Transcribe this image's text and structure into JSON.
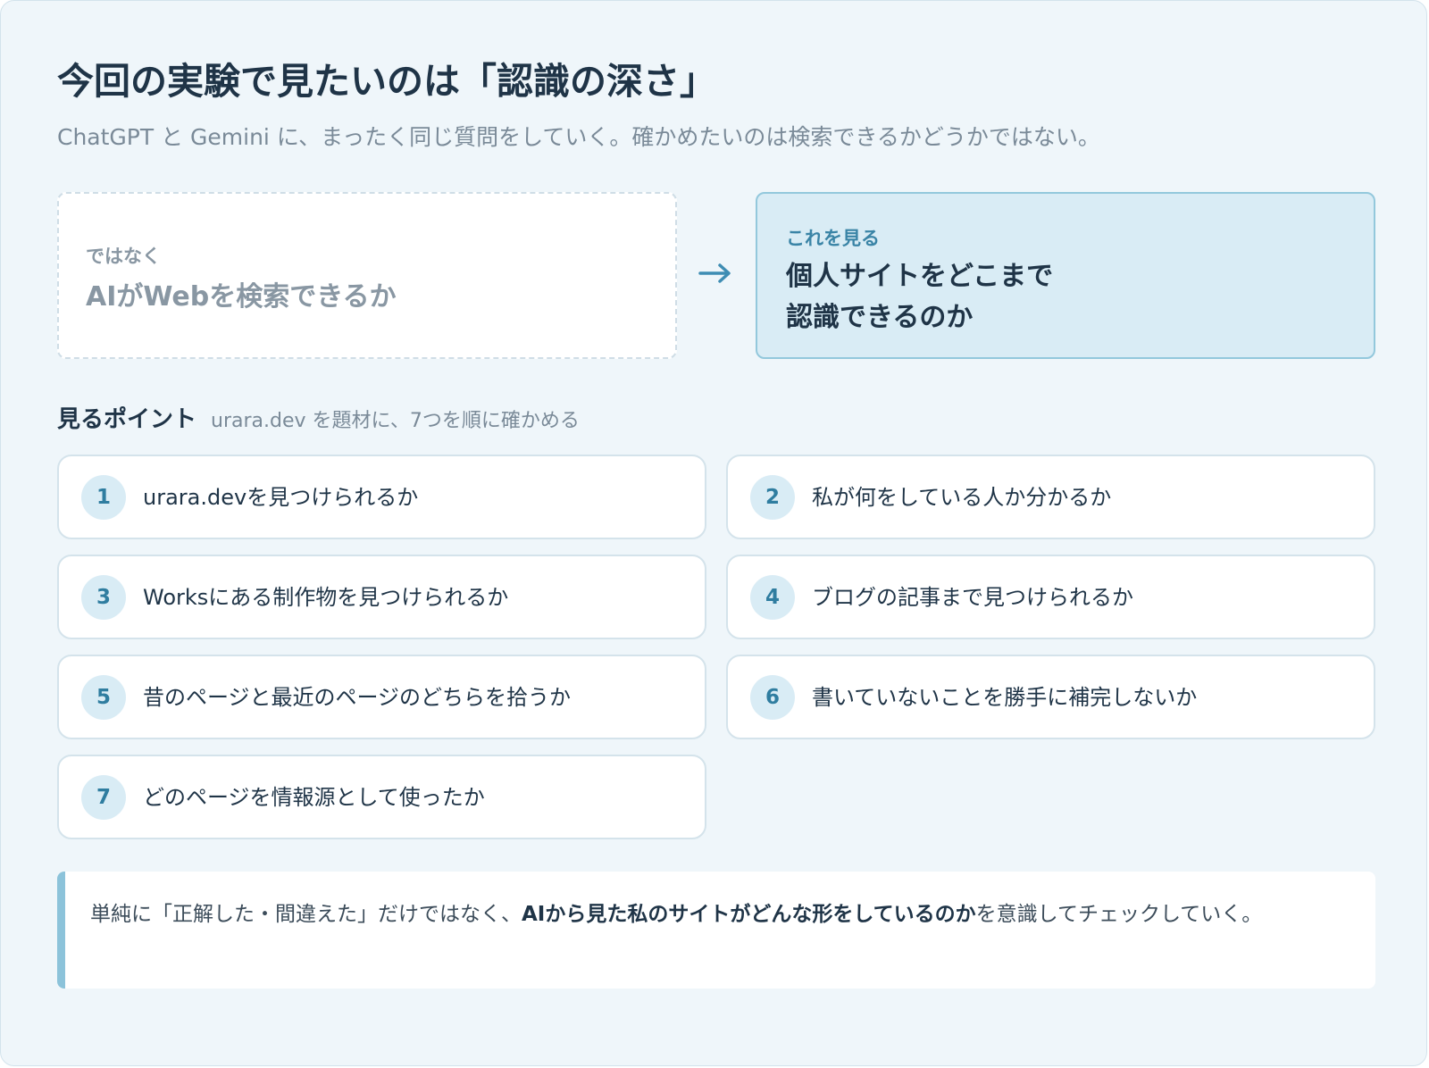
{
  "header": {
    "title": "今回の実験で見たいのは「認識の深さ」",
    "subtitle": "ChatGPT と Gemini に、まったく同じ質問をしていく。確かめたいのは検索できるかどうかではない。"
  },
  "comparison": {
    "not": {
      "label": "ではなく",
      "text": "AIがWebを検索できるか"
    },
    "arrow_icon": "right-arrow-icon",
    "instead": {
      "label": "これを見る",
      "line1": "個人サイトをどこまで",
      "line2": "認識できるのか"
    }
  },
  "points": {
    "heading": "見るポイント",
    "note": "urara.dev を題材に、7つを順に確かめる",
    "items": [
      {
        "num": "1",
        "text": "urara.devを見つけられるか"
      },
      {
        "num": "2",
        "text": "私が何をしている人か分かるか"
      },
      {
        "num": "3",
        "text": "Worksにある制作物を見つけられるか"
      },
      {
        "num": "4",
        "text": "ブログの記事まで見つけられるか"
      },
      {
        "num": "5",
        "text": "昔のページと最近のページのどちらを拾うか"
      },
      {
        "num": "6",
        "text": "書いていないことを勝手に補完しないか"
      },
      {
        "num": "7",
        "text": "どのページを情報源として使ったか"
      }
    ]
  },
  "callout": {
    "before": "単純に「正解した・間違えた」だけではなく、",
    "emphasis": "AIから見た私のサイトがどんな形をしているのか",
    "after": "を意識してチェックしていく。"
  },
  "colors": {
    "background": "#eff6fa",
    "accent": "#3a84a6",
    "highlight_box": "#d9ecf5",
    "text": "#1f3447",
    "muted": "#7a8a98"
  }
}
